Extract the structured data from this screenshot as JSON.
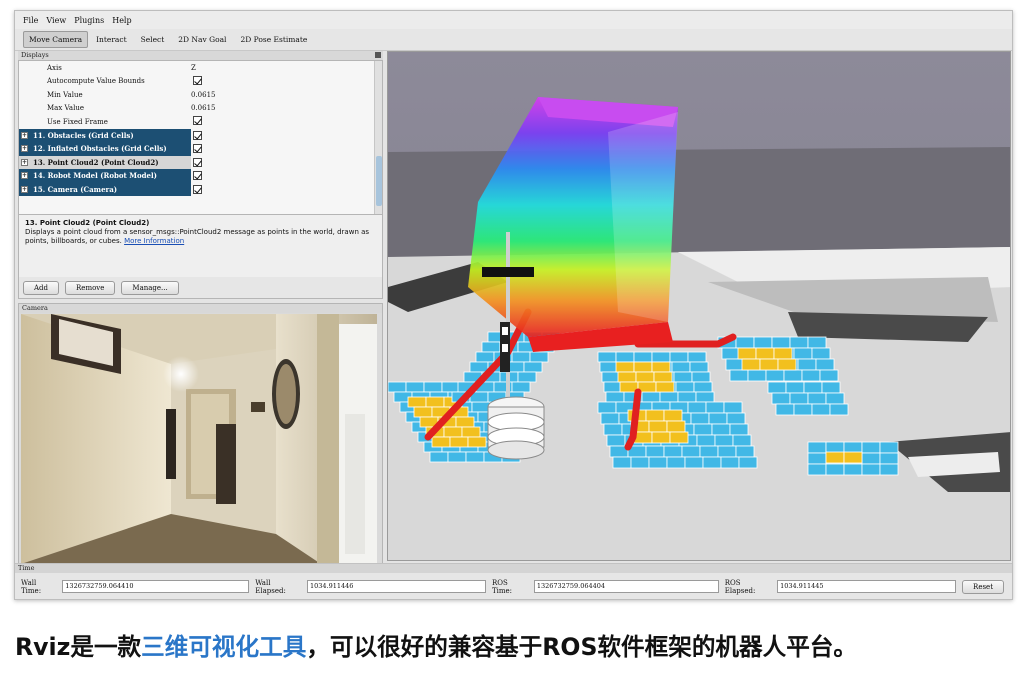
{
  "menu": [
    "File",
    "View",
    "Plugins",
    "Help"
  ],
  "toolbar": {
    "tools": [
      "Move Camera",
      "Interact",
      "Select",
      "2D Nav Goal",
      "2D Pose Estimate"
    ],
    "active": "Move Camera"
  },
  "displays": {
    "panel_title": "Displays",
    "rows": [
      {
        "label": "Axis",
        "value": "Z"
      },
      {
        "label": "Autocompute Value Bounds",
        "checked": true
      },
      {
        "label": "Min Value",
        "value": "0.0615"
      },
      {
        "label": "Max Value",
        "value": "0.0615"
      },
      {
        "label": "Use Fixed Frame",
        "checked": true
      },
      {
        "label": "11. Obstacles (Grid Cells)",
        "checked": true
      },
      {
        "label": "12. Inflated Obstacles (Grid Cells)",
        "checked": true
      },
      {
        "label": "13. Point Cloud2 (Point Cloud2)",
        "checked": true
      },
      {
        "label": "14. Robot Model (Robot Model)",
        "checked": true
      },
      {
        "label": "15. Camera (Camera)",
        "checked": true
      }
    ]
  },
  "description": {
    "title": "13. Point Cloud2 (Point Cloud2)",
    "text": "Displays a point cloud from a sensor_msgs::PointCloud2 message as points in the world, drawn as points, billboards, or cubes.",
    "link": "More Information"
  },
  "buttons": {
    "add": "Add",
    "remove": "Remove",
    "manage": "Manage..."
  },
  "camera": {
    "panel_title": "Camera"
  },
  "time": {
    "panel_title": "Time",
    "wall_time_label": "Wall Time:",
    "wall_time": "1326732759.064410",
    "wall_elapsed_label": "Wall Elapsed:",
    "wall_elapsed": "1034.911446",
    "ros_time_label": "ROS Time:",
    "ros_time": "1326732759.064404",
    "ros_elapsed_label": "ROS Elapsed:",
    "ros_elapsed": "1034.911445",
    "reset": "Reset"
  },
  "caption": {
    "pre": "Rviz是一款",
    "highlight": "三维可视化工具",
    "post": "，可以很好的兼容基于ROS软件框架的机器人平台。"
  },
  "colors": {
    "highlight_row": "#1c4f73",
    "caption_accent": "#2a76c8",
    "grid_obstacle": "#41b8e6",
    "grid_inflated": "#f2c01e",
    "grid_path": "#e02020"
  }
}
